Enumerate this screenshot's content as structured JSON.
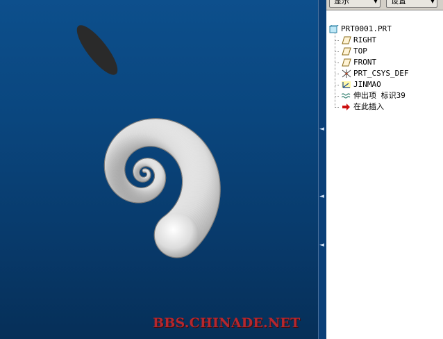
{
  "toolbar": {
    "show_label": "显示",
    "settings_label": "设置"
  },
  "tree": {
    "root": {
      "label": "PRT0001.PRT",
      "icon": "part-icon"
    },
    "items": [
      {
        "label": "RIGHT",
        "icon": "datum-plane-icon"
      },
      {
        "label": "TOP",
        "icon": "datum-plane-icon"
      },
      {
        "label": "FRONT",
        "icon": "datum-plane-icon"
      },
      {
        "label": "PRT_CSYS_DEF",
        "icon": "coordinate-system-icon"
      },
      {
        "label": "JINMAO",
        "icon": "sketch-curve-icon"
      },
      {
        "label": "伸出项 标识39",
        "icon": "protrusion-icon"
      },
      {
        "label": "在此插入",
        "icon": "insert-here-arrow-icon"
      }
    ]
  },
  "watermark": "BBS.CHINADE.NET",
  "colors": {
    "viewport_bg": "#0a467e",
    "watermark": "#b5272e",
    "insert_arrow": "#cc1010"
  }
}
